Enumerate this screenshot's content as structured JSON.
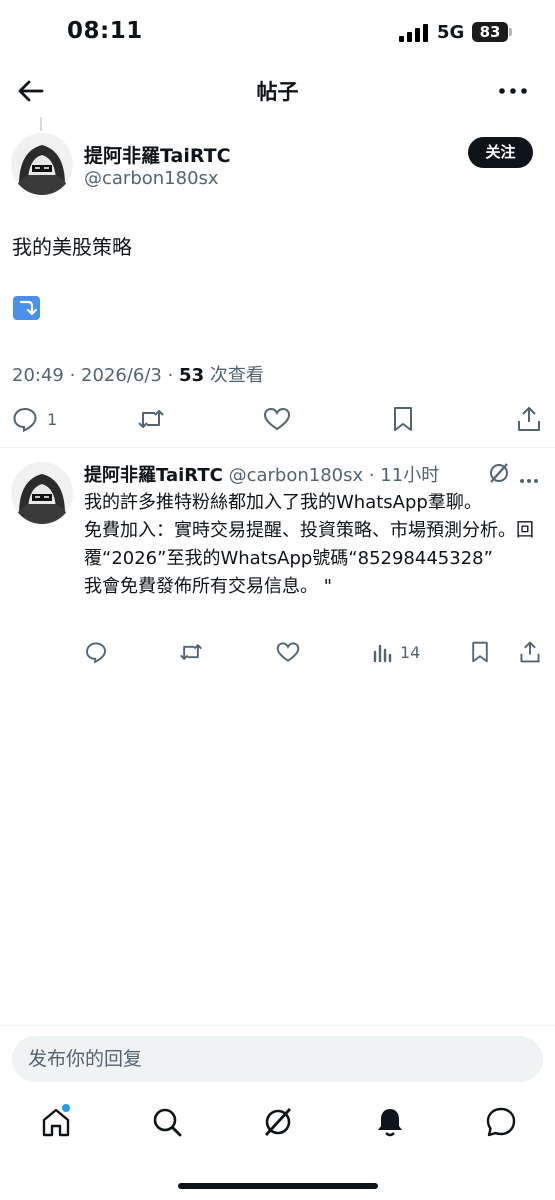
{
  "status_bar": {
    "time": "08:11",
    "network": "5G",
    "battery": "83"
  },
  "header": {
    "title": "帖子"
  },
  "post": {
    "author_name": "提阿非羅TaiRTC",
    "handle": "@carbon180sx",
    "follow_label": "关注",
    "text": "我的美股策略",
    "time": "20:49 · 2026/6/3 · ",
    "views": "53",
    "views_label": " 次查看",
    "reply_count": "1"
  },
  "reply": {
    "author_name": "提阿非羅TaiRTC",
    "handle": "@carbon180sx · 11小时",
    "text": "我的許多推特粉絲都加入了我的WhatsApp羣聊。\n免費加入：實時交易提醒、投資策略、市場預測分析。回覆“2026”至我的WhatsApp號碼“85298445328”\n我會免費發佈所有交易信息。 \"",
    "view_count": "14"
  },
  "compose": {
    "placeholder": "发布你的回复"
  },
  "icons": {
    "back": "back-arrow-icon",
    "more": "more-horizontal-icon",
    "reply": "reply-icon",
    "retweet": "retweet-icon",
    "like": "heart-icon",
    "bookmark": "bookmark-icon",
    "share": "share-icon",
    "views": "views-chart-icon",
    "grok": "grok-icon",
    "home": "home-icon",
    "search": "search-icon",
    "notifications": "bell-icon",
    "messages": "message-icon"
  },
  "colors": {
    "text": "#0f1419",
    "secondary": "#536471",
    "accent": "#1d9bf0",
    "follow_bg": "#0f1419",
    "divider": "#eff3f4"
  }
}
